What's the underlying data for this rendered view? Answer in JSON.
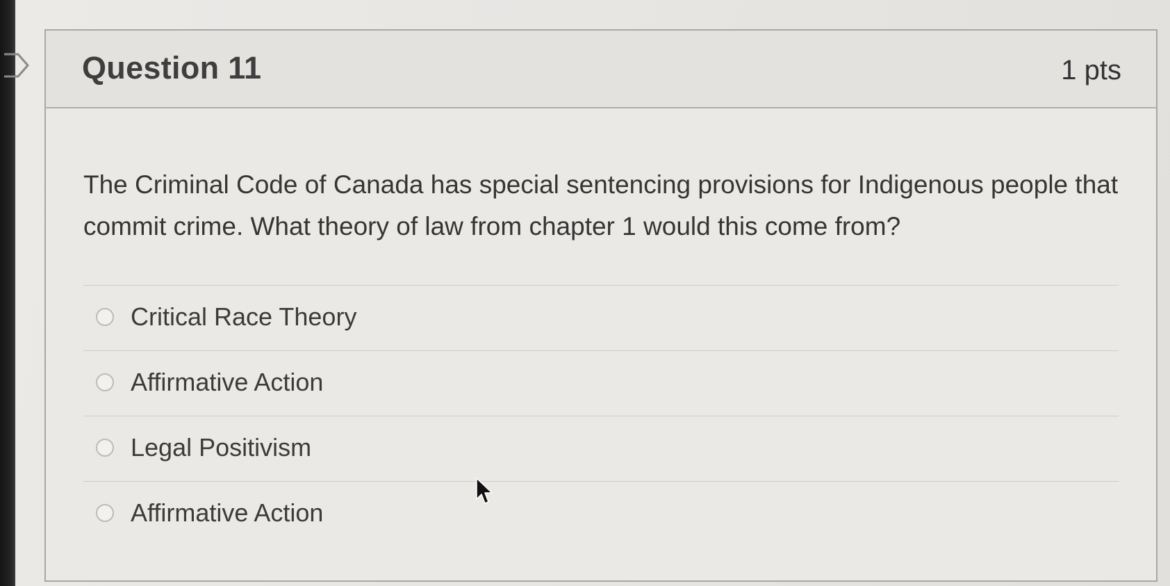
{
  "question": {
    "title": "Question 11",
    "points": "1 pts",
    "text": "The Criminal Code of Canada has special sentencing provisions for Indigenous people that commit crime. What theory of law from chapter 1 would this come from?"
  },
  "answers": [
    {
      "label": "Critical Race Theory",
      "selected": false
    },
    {
      "label": "Affirmative Action",
      "selected": false
    },
    {
      "label": "Legal Positivism",
      "selected": false
    },
    {
      "label": "Affirmative Action",
      "selected": false
    }
  ],
  "icons": {
    "flag": "flag-icon",
    "cursor": "mouse-pointer-icon",
    "radio": "radio-button"
  },
  "colors": {
    "background": "#ebe9e6",
    "header_background": "#e4e2df",
    "border": "#a9a7a4",
    "text": "#353535"
  }
}
